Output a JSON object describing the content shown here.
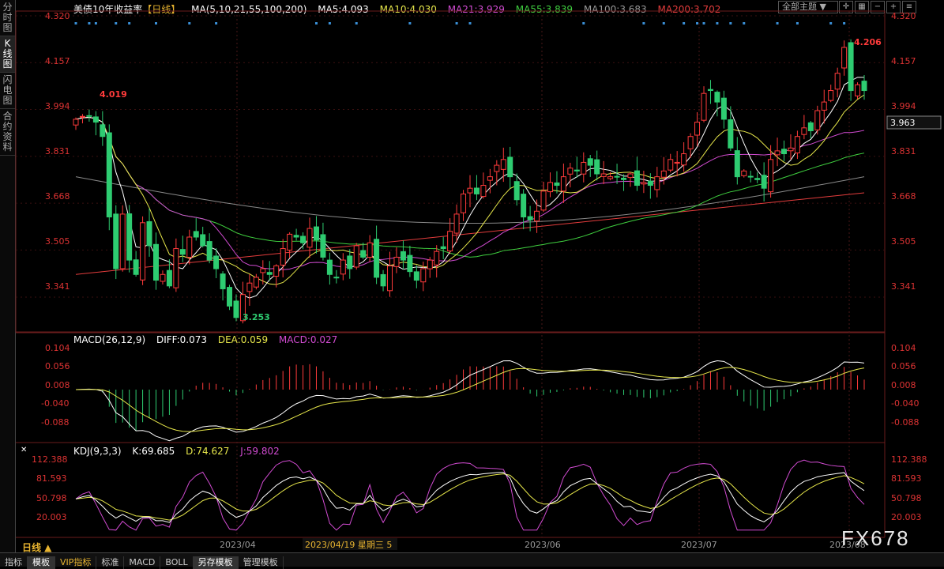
{
  "sidebar": {
    "tabs": [
      "分时图",
      "K线图",
      "闪电图",
      "合约资料"
    ]
  },
  "header": {
    "title": "美债10年收益率",
    "period": "【日线】",
    "ma_label": "MA(5,10,21,55,100,200)",
    "ma5": "MA5:4.093",
    "ma10": "MA10:4.030",
    "ma21": "MA21:3.929",
    "ma55": "MA55:3.839",
    "ma100": "MA100:3.683",
    "ma200": "MA200:3.702",
    "theme": "全部主题"
  },
  "price_axis": [
    "4.320",
    "4.157",
    "3.994",
    "3.831",
    "3.668",
    "3.505",
    "3.341"
  ],
  "last_price": "3.963",
  "annotations": {
    "high_left": "4.019",
    "low": "3.253",
    "high_right": "4.206"
  },
  "macd": {
    "label": "MACD(26,12,9)",
    "diff": "DIFF:0.073",
    "dea": "DEA:0.059",
    "macd": "MACD:0.027",
    "axis": [
      "0.104",
      "0.056",
      "0.008",
      "-0.040",
      "-0.088"
    ]
  },
  "kdj": {
    "label": "KDJ(9,3,3)",
    "k": "K:69.685",
    "d": "D:74.627",
    "j": "J:59.802",
    "axis": [
      "112.388",
      "81.593",
      "50.798",
      "20.003"
    ]
  },
  "dates": [
    "2023/04",
    "2023/06",
    "2023/07",
    "2023/08"
  ],
  "cursor_date": "2023/04/19 星期三 5",
  "period_button": "日线 ▲",
  "bottom_tabs": [
    "指标",
    "模板",
    "VIP指标",
    "标准",
    "MACD",
    "BOLL",
    "另存模板",
    "管理模板"
  ],
  "watermark": "FX678",
  "colors": {
    "up": "#ff3b3b",
    "down": "#2ecc71",
    "ma5": "#ffffff",
    "ma10": "#e6e64a",
    "ma21": "#d14bd1",
    "ma55": "#3fcf3f",
    "ma100": "#888888",
    "ma200": "#e23c3c"
  },
  "chart_data": {
    "type": "candlestick",
    "title": "美债10年收益率",
    "ylim": [
      3.22,
      4.32
    ],
    "close": [
      3.96,
      3.97,
      3.97,
      3.95,
      3.9,
      3.62,
      3.44,
      3.63,
      3.47,
      3.42,
      3.6,
      3.52,
      3.4,
      3.42,
      3.38,
      3.51,
      3.49,
      3.55,
      3.55,
      3.52,
      3.47,
      3.44,
      3.37,
      3.31,
      3.27,
      3.35,
      3.39,
      3.41,
      3.44,
      3.42,
      3.45,
      3.51,
      3.56,
      3.55,
      3.53,
      3.58,
      3.54,
      3.48,
      3.42,
      3.41,
      3.47,
      3.44,
      3.52,
      3.48,
      3.53,
      3.41,
      3.38,
      3.45,
      3.48,
      3.47,
      3.43,
      3.4,
      3.44,
      3.47,
      3.5,
      3.51,
      3.57,
      3.63,
      3.7,
      3.72,
      3.7,
      3.73,
      3.76,
      3.8,
      3.82,
      3.76,
      3.68,
      3.62,
      3.61,
      3.64,
      3.71,
      3.74,
      3.73,
      3.76,
      3.79,
      3.78,
      3.81,
      3.8,
      3.77,
      3.77,
      3.76,
      3.76,
      3.75,
      3.77,
      3.73,
      3.74,
      3.73,
      3.76,
      3.78,
      3.82,
      3.81,
      3.84,
      3.9,
      3.95,
      4.05,
      4.06,
      4.02,
      3.96,
      3.86,
      3.76,
      3.78,
      3.76,
      3.75,
      3.72,
      3.82,
      3.85,
      3.84,
      3.86,
      3.9,
      3.93,
      3.92,
      3.99,
      4.02,
      4.06,
      4.12,
      4.21,
      4.06,
      4.08,
      4.06
    ]
  }
}
